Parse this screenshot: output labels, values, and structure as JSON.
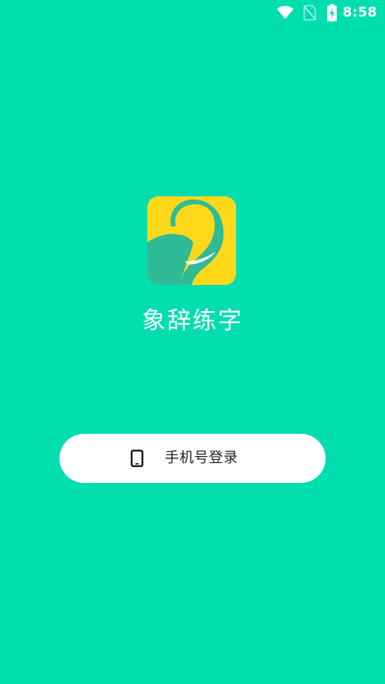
{
  "status_bar": {
    "time": "8:58",
    "icons": [
      "wifi-icon",
      "no-sim-icon",
      "battery-charging-icon"
    ]
  },
  "app": {
    "logo_icon": "elephant-logo-icon",
    "name": "象辞练字"
  },
  "login": {
    "phone_button_icon": "phone-icon",
    "phone_button_label": "手机号登录"
  },
  "colors": {
    "background": "#00DEB0",
    "logo_yellow": "#FFD81A",
    "logo_teal": "#30BB97",
    "button_bg": "#FFFFFF",
    "button_text": "#1F1F1F",
    "app_name_text": "#FFFFFF"
  }
}
